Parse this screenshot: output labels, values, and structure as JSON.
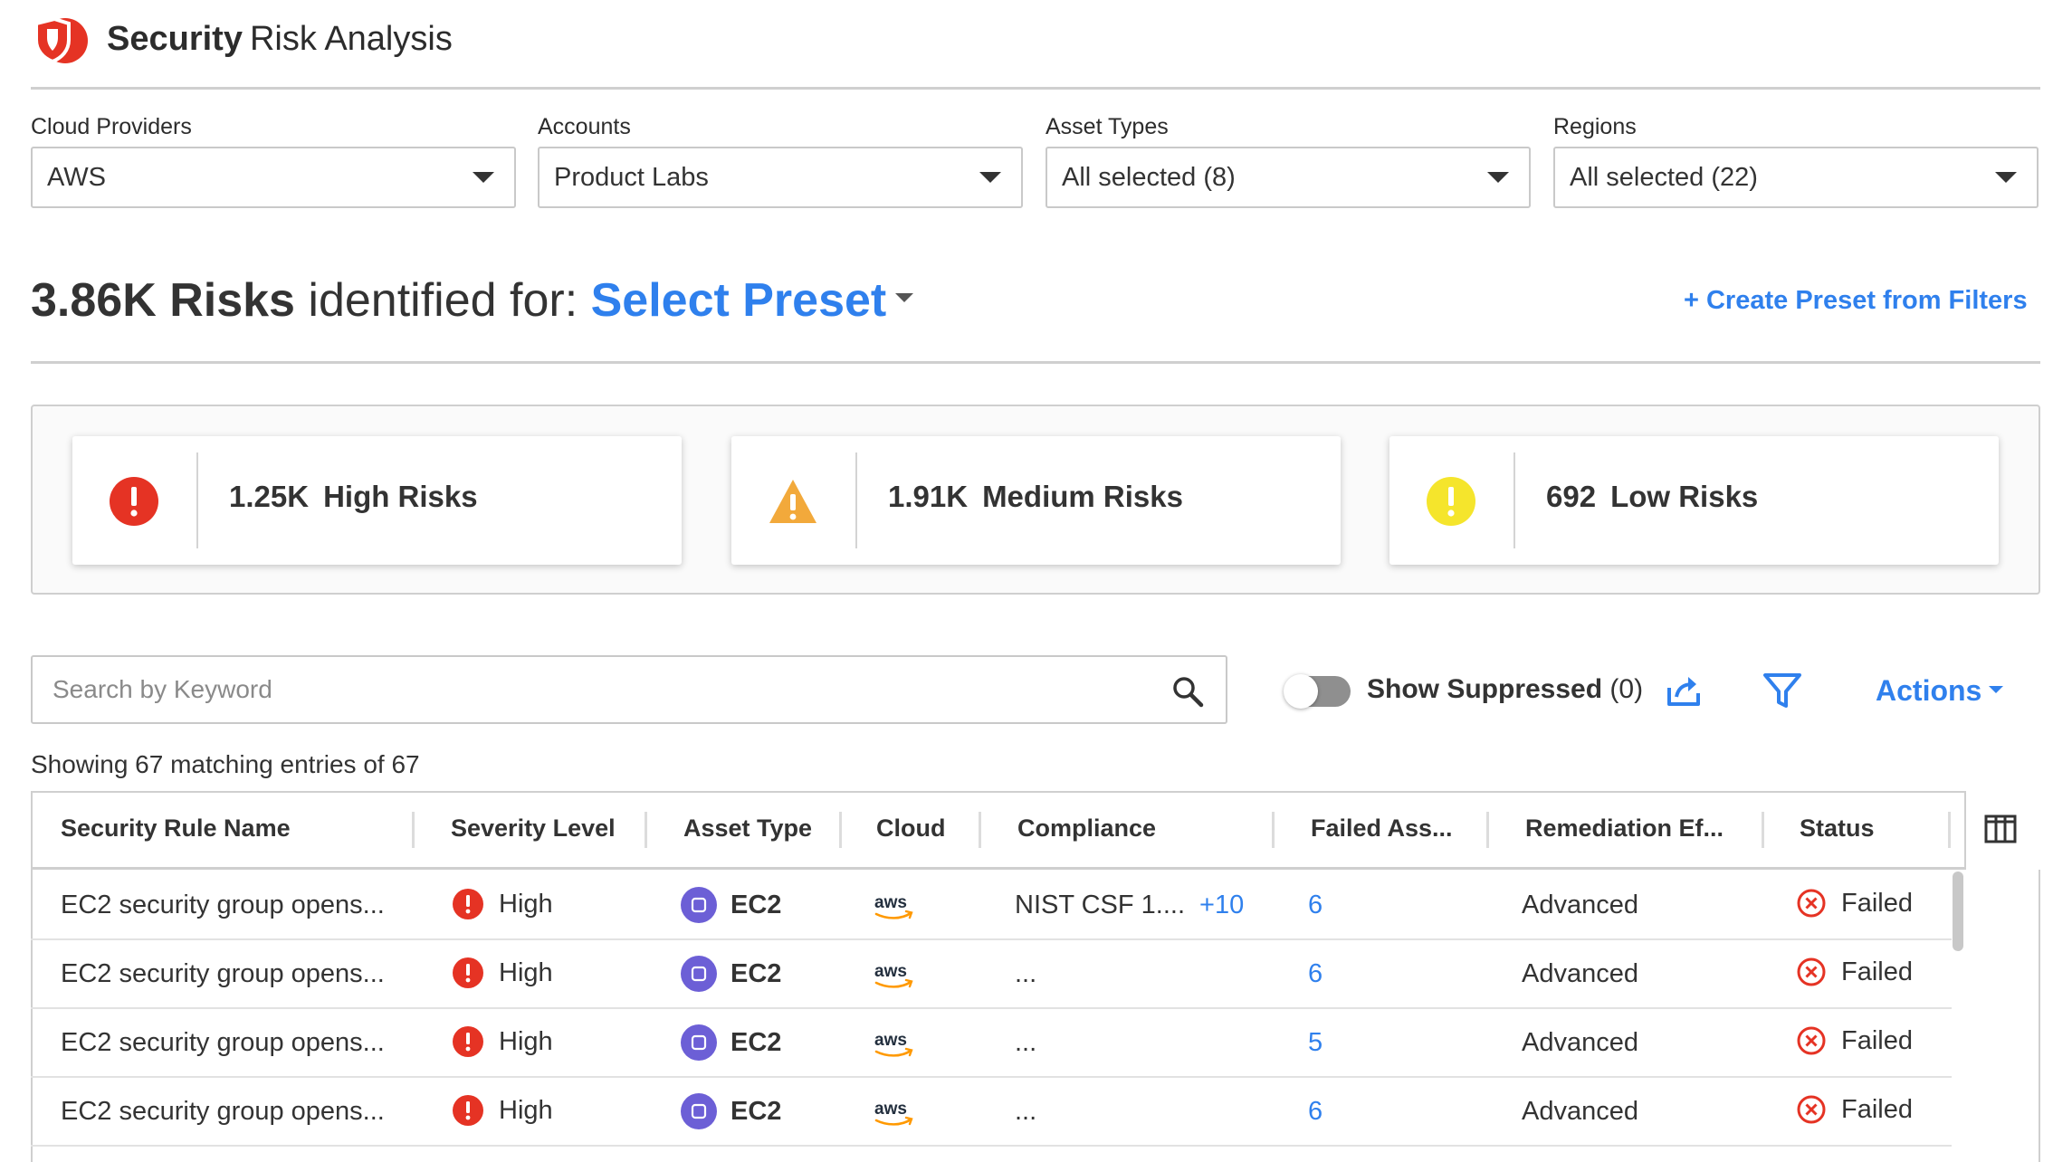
{
  "header": {
    "brand": "Security",
    "subtitle": "Risk Analysis"
  },
  "colors": {
    "accent": "#2f80ed",
    "high": "#e53324",
    "medium": "#f2a93b",
    "low": "#f5e52c",
    "ec2": "#6c5fd6",
    "aws_orange": "#ff9900"
  },
  "filters": [
    {
      "label": "Cloud Providers",
      "value": "AWS"
    },
    {
      "label": "Accounts",
      "value": "Product Labs"
    },
    {
      "label": "Asset Types",
      "value": "All selected (8)"
    },
    {
      "label": "Regions",
      "value": "All selected (22)"
    }
  ],
  "headline": {
    "count": "3.86K Risks",
    "text": " identified for: ",
    "preset": "Select Preset"
  },
  "create_preset": "+ Create Preset from Filters",
  "summary": [
    {
      "icon": "high-risk-icon",
      "count": "1.25K",
      "label": "High Risks"
    },
    {
      "icon": "medium-risk-icon",
      "count": "1.91K",
      "label": "Medium Risks"
    },
    {
      "icon": "low-risk-icon",
      "count": "692",
      "label": "Low Risks"
    }
  ],
  "toolbar": {
    "search_placeholder": "Search by Keyword",
    "show_suppressed": "Show Suppressed",
    "suppressed_count": " (0)",
    "actions": "Actions"
  },
  "showing": "Showing 67 matching entries of 67",
  "table": {
    "columns": [
      "Security Rule Name",
      "Severity Level",
      "Asset Type",
      "Cloud",
      "Compliance",
      "Failed Ass...",
      "Remediation Ef...",
      "Status"
    ],
    "rows": [
      {
        "rule": "EC2 security group opens...",
        "severity": "High",
        "asset": "EC2",
        "cloud": "aws",
        "compliance": "NIST CSF 1....",
        "compliance_more": "+10",
        "failed": "6",
        "remediation": "Advanced",
        "status": "Failed"
      },
      {
        "rule": "EC2 security group opens...",
        "severity": "High",
        "asset": "EC2",
        "cloud": "aws",
        "compliance": "...",
        "compliance_more": "",
        "failed": "6",
        "remediation": "Advanced",
        "status": "Failed"
      },
      {
        "rule": "EC2 security group opens...",
        "severity": "High",
        "asset": "EC2",
        "cloud": "aws",
        "compliance": "...",
        "compliance_more": "",
        "failed": "5",
        "remediation": "Advanced",
        "status": "Failed"
      },
      {
        "rule": "EC2 security group opens...",
        "severity": "High",
        "asset": "EC2",
        "cloud": "aws",
        "compliance": "...",
        "compliance_more": "",
        "failed": "6",
        "remediation": "Advanced",
        "status": "Failed"
      }
    ]
  }
}
